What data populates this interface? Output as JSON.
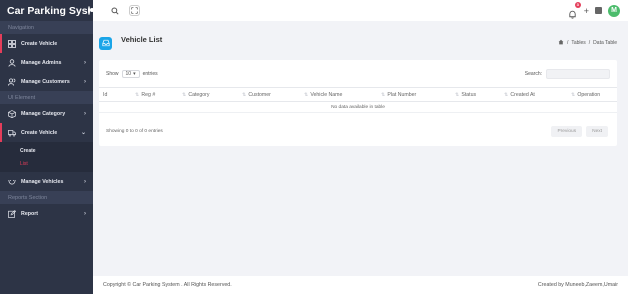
{
  "app": {
    "brand": "Car Parking Sys"
  },
  "sidebar": {
    "sections": {
      "navigation": "Navigation",
      "ui_element": "UI Element",
      "reports": "Reports Section"
    },
    "items": {
      "create_vehicle_top": "Create Vehicle",
      "manage_admins": "Manage Admins",
      "manage_customers": "Manage Customers",
      "manage_category": "Manage Category",
      "create_vehicle": "Create Vehicle",
      "sub_create": "Create",
      "sub_list": "List",
      "manage_vehicles": "Manage Vehicles",
      "report": "Report"
    },
    "chevron_right": "›",
    "chevron_down": "⌄"
  },
  "topbar": {
    "notification_count": "3",
    "avatar_initial": "M",
    "plus": "+"
  },
  "page": {
    "title": "Vehicle List",
    "breadcrumb": {
      "sep": "/",
      "tables": "Tables",
      "current": "Data Table"
    }
  },
  "table": {
    "show_label": "Show",
    "entries_value": "10",
    "entries_label": "entries",
    "search_label": "Search:",
    "columns": [
      "Id",
      "Reg #",
      "Category",
      "Customer",
      "Vehicle Name",
      "Plat Number",
      "Status",
      "Created At",
      "Operation"
    ],
    "empty_message": "No data available in table",
    "info": "Showing 0 to 0 of 0 entries",
    "prev": "Previous",
    "next": "Next"
  },
  "footer": {
    "copyright": "Copyright © Car Parking System . All Rights Reserved.",
    "credit": "Created by Muneeb,Zaeem,Umair"
  },
  "colors": {
    "sidebar": "#2d3446",
    "accent": "#1aa5e8",
    "active": "#e43d5a",
    "avatar": "#4cbc6c"
  }
}
